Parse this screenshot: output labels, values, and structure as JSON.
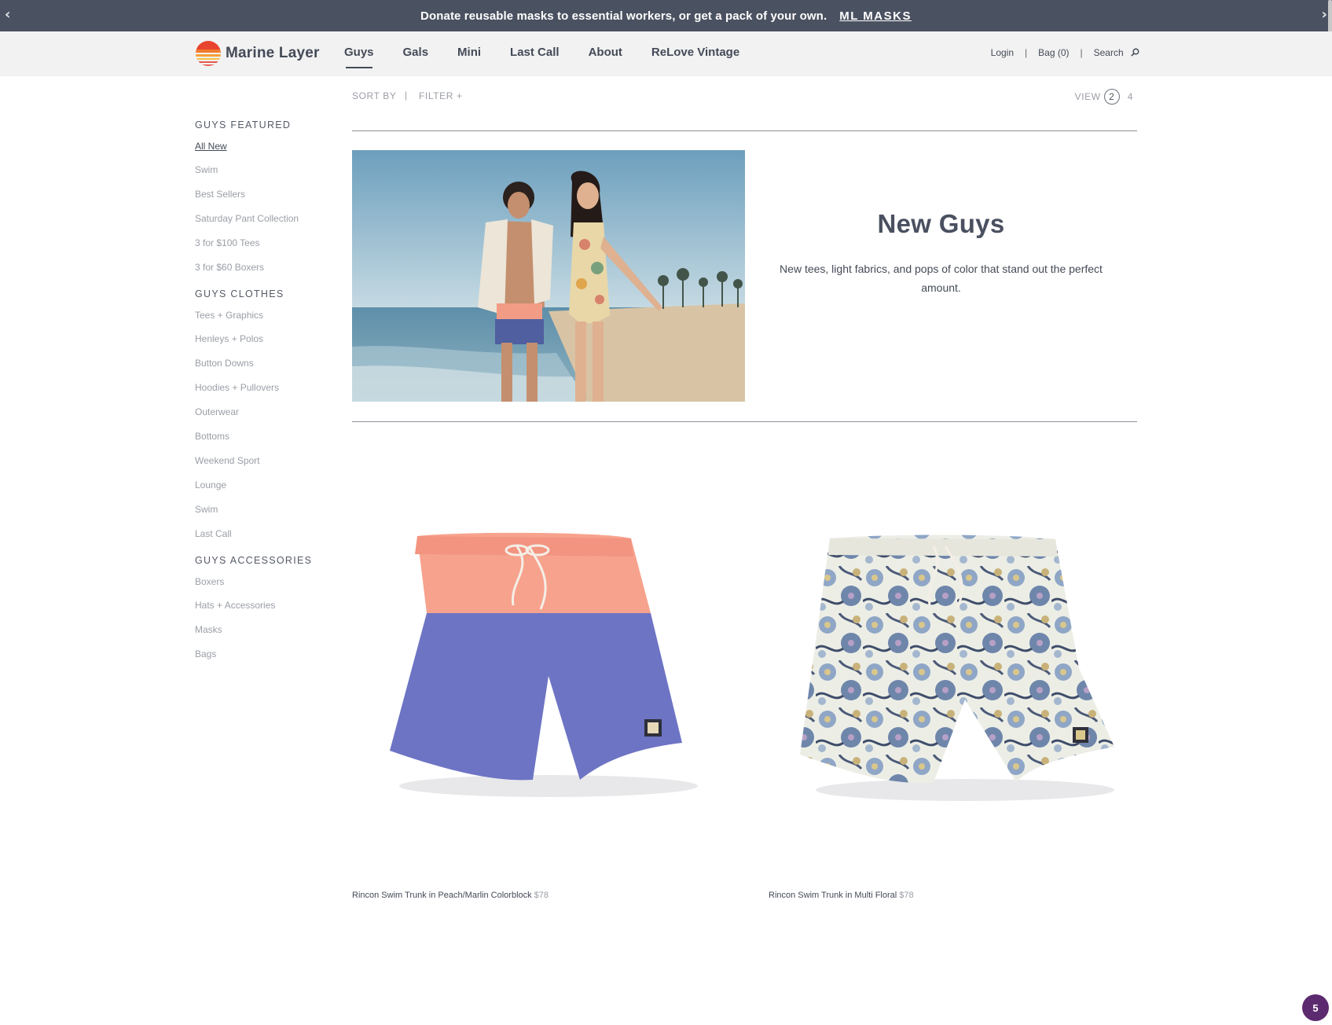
{
  "announcement": {
    "message": "Donate reusable masks to essential workers, or get a pack of your own.",
    "cta": "ML MASKS",
    "prev_icon": "chevron-left-icon",
    "next_icon": "chevron-right-icon"
  },
  "header": {
    "brand": "Marine Layer",
    "nav": [
      {
        "label": "Guys",
        "active": true
      },
      {
        "label": "Gals"
      },
      {
        "label": "Mini"
      },
      {
        "label": "Last Call"
      },
      {
        "label": "About"
      },
      {
        "label": "ReLove Vintage"
      }
    ],
    "login": "Login",
    "separator": "|",
    "bag": "Bag (0)",
    "search": "Search"
  },
  "toolbar": {
    "sort": "SORT BY",
    "separator": "|",
    "filter": "FILTER +",
    "view_label": "VIEW",
    "view_option_selected": "2",
    "view_option_other": "4"
  },
  "sidebar": {
    "groups": [
      {
        "title": "GUYS FEATURED",
        "items": [
          "All New",
          "Swim",
          "Best Sellers",
          "Saturday Pant Collection",
          "3 for $100 Tees",
          "3 for $60 Boxers"
        ]
      },
      {
        "title": "GUYS CLOTHES",
        "items": [
          "Tees + Graphics",
          "Henleys + Polos",
          "Button Downs",
          "Hoodies + Pullovers",
          "Outerwear",
          "Bottoms",
          "Weekend Sport",
          "Lounge",
          "Swim",
          "Last Call"
        ]
      },
      {
        "title": "GUYS ACCESSORIES",
        "items": [
          "Boxers",
          "Hats + Accessories",
          "Masks",
          "Bags"
        ]
      }
    ]
  },
  "hero": {
    "title": "New Guys",
    "description": "New tees, light fabrics, and pops of color that stand out the perfect amount."
  },
  "products": [
    {
      "name": "Rincon Swim Trunk in Peach/Marlin Colorblock",
      "price": "$78"
    },
    {
      "name": "Rincon Swim Trunk in Multi Floral",
      "price": "$78"
    }
  ],
  "chat_badge": "5",
  "colors": {
    "announcement_bg": "#4a5160",
    "header_bg": "#f2f2f2",
    "text_primary": "#444a57",
    "text_muted": "#9a9ea6",
    "peach": "#f7a28d",
    "marlin_blue": "#6d74c4",
    "badge": "#5c2a6e"
  }
}
